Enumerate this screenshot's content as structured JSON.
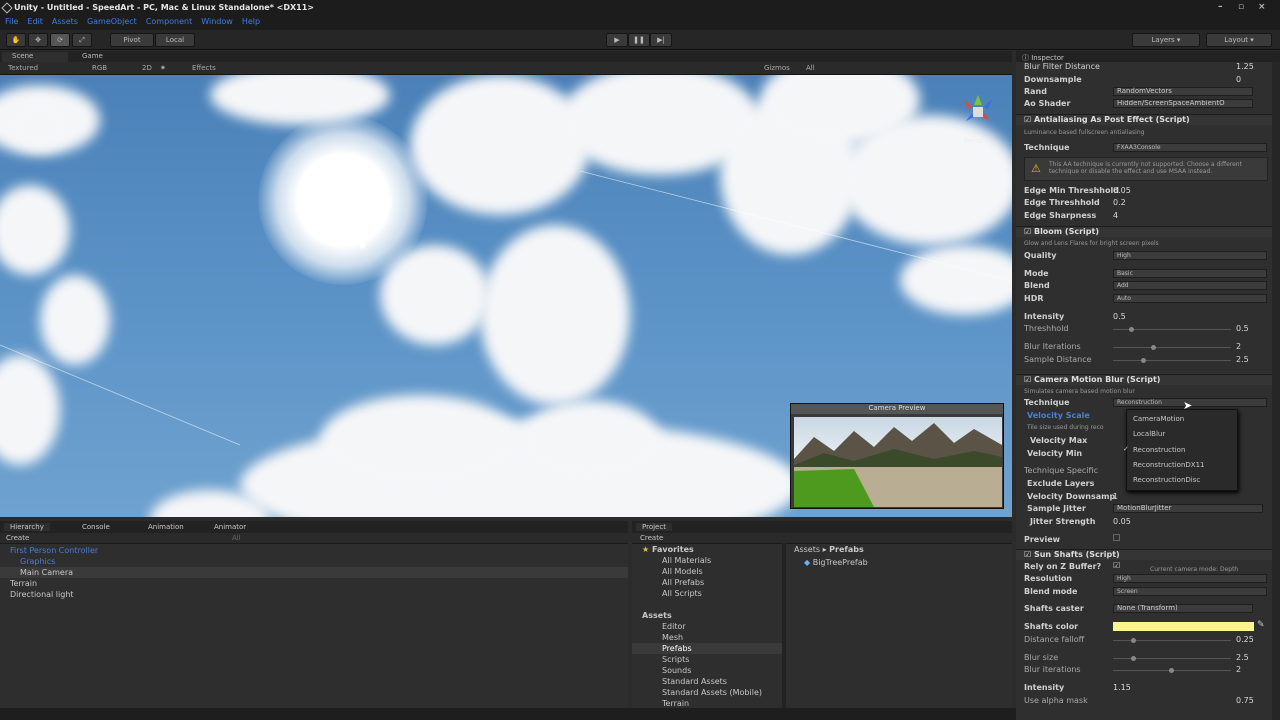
{
  "window": {
    "title": "Unity - Untitled - SpeedArt - PC, Mac & Linux Standalone* <DX11>"
  },
  "menu": [
    "File",
    "Edit",
    "Assets",
    "GameObject",
    "Component",
    "Window",
    "Help"
  ],
  "toolbar": {
    "pivot": "Pivot",
    "local": "Local",
    "layers": "Layers",
    "layout": "Layout"
  },
  "scene": {
    "tabs": [
      "Scene",
      "Game"
    ],
    "shading": "Textured",
    "rgb": "RGB",
    "mode2d": "2D",
    "effects": "Effects",
    "gizmos": "Gizmos",
    "search": "All",
    "persp": "Persp"
  },
  "camera_preview": {
    "title": "Camera Preview"
  },
  "hierarchy": {
    "tabs": [
      "Hierarchy",
      "Console",
      "Animation",
      "Animator"
    ],
    "create": "Create",
    "search": "All",
    "items": [
      "First Person Controller",
      "Graphics",
      "Main Camera",
      "Terrain",
      "Directional light"
    ]
  },
  "project": {
    "tab": "Project",
    "create": "Create",
    "favorites_label": "Favorites",
    "favorites": [
      "All Materials",
      "All Models",
      "All Prefabs",
      "All Scripts"
    ],
    "assets_label": "Assets",
    "assets": [
      "Editor",
      "Mesh",
      "Prefabs",
      "Scripts",
      "Sounds",
      "Standard Assets",
      "Standard Assets (Mobile)",
      "Terrain"
    ],
    "breadcrumb_root": "Assets",
    "breadcrumb_sep": "▸",
    "breadcrumb_leaf": "Prefabs",
    "files": [
      "BigTreePrefab"
    ]
  },
  "inspector": {
    "tab": "Inspector",
    "rows_top": [
      {
        "label": "Blur Filter Distance",
        "value": "1.25"
      },
      {
        "label": "Downsample",
        "value": "0"
      },
      {
        "label": "Rand",
        "value": "RandomVectors"
      },
      {
        "label": "Ao Shader",
        "value": "Hidden/ScreenSpaceAmbientO"
      }
    ],
    "aa": {
      "title": "Antialiasing As Post Effect (Script)",
      "desc": "Luminance based fullscreen antialiasing",
      "technique_label": "Technique",
      "technique": "FXAA3Console",
      "warning": "This AA technique is currently not supported. Choose a different technique or disable the effect and use MSAA instead.",
      "rows": [
        {
          "label": "Edge Min Threshhold",
          "value": "0.05"
        },
        {
          "label": "Edge Threshhold",
          "value": "0.2"
        },
        {
          "label": "Edge Sharpness",
          "value": "4"
        }
      ]
    },
    "bloom": {
      "title": "Bloom (Script)",
      "desc": "Glow and Lens Flares for bright screen pixels",
      "quality_label": "Quality",
      "quality": "High",
      "mode_label": "Mode",
      "mode": "Basic",
      "blend_label": "Blend",
      "blend": "Add",
      "hdr_label": "HDR",
      "hdr": "Auto",
      "intensity_label": "Intensity",
      "intensity": "0.5",
      "threshold_label": "Threshhold",
      "threshold": "0.5",
      "blur_iter_label": "Blur Iterations",
      "blur_iter": "2",
      "sample_label": "Sample Distance",
      "sample": "2.5"
    },
    "cmb": {
      "title": "Camera Motion Blur (Script)",
      "desc": "Simulates camera based motion blur",
      "technique_label": "Technique",
      "technique": "Reconstruction",
      "vscale_label": "Velocity Scale",
      "tile_label": "Tile size used during reco",
      "vmax_label": "Velocity Max",
      "vmin_label": "Velocity Min",
      "specific_label": "Technique Specific",
      "exclude_label": "Exclude Layers",
      "downsample_label": "Velocity Downsamp",
      "downsample": "1",
      "jitter_label": "Sample Jitter",
      "jitter": "MotionBlurJitter",
      "jstrength_label": "Jitter Strength",
      "jstrength": "0.05",
      "preview_label": "Preview",
      "options": [
        "CameraMotion",
        "LocalBlur",
        "Reconstruction",
        "ReconstructionDX11",
        "ReconstructionDisc"
      ],
      "selected": "Reconstruction"
    },
    "sun": {
      "title": "Sun Shafts (Script)",
      "zbuf_label": "Rely on Z Buffer?",
      "mode_note": "Current camera mode: Depth",
      "res_label": "Resolution",
      "res": "High",
      "blendmode_label": "Blend mode",
      "blendmode": "Screen",
      "caster_label": "Shafts caster",
      "caster": "None (Transform)",
      "color_label": "Shafts color",
      "shafts_color": "#fbf58a",
      "falloff_label": "Distance falloff",
      "falloff": "0.25",
      "blur_label": "Blur size",
      "blur": "2.5",
      "biter_label": "Blur iterations",
      "biter": "2",
      "intensity_label": "Intensity",
      "intensity": "1.15",
      "alpha_label": "Use alpha mask",
      "alpha": "0.75"
    }
  },
  "colors": {
    "accent": "#3b7ee8",
    "selected_item": "#4b7ed8",
    "sky": "#5d94c8"
  }
}
